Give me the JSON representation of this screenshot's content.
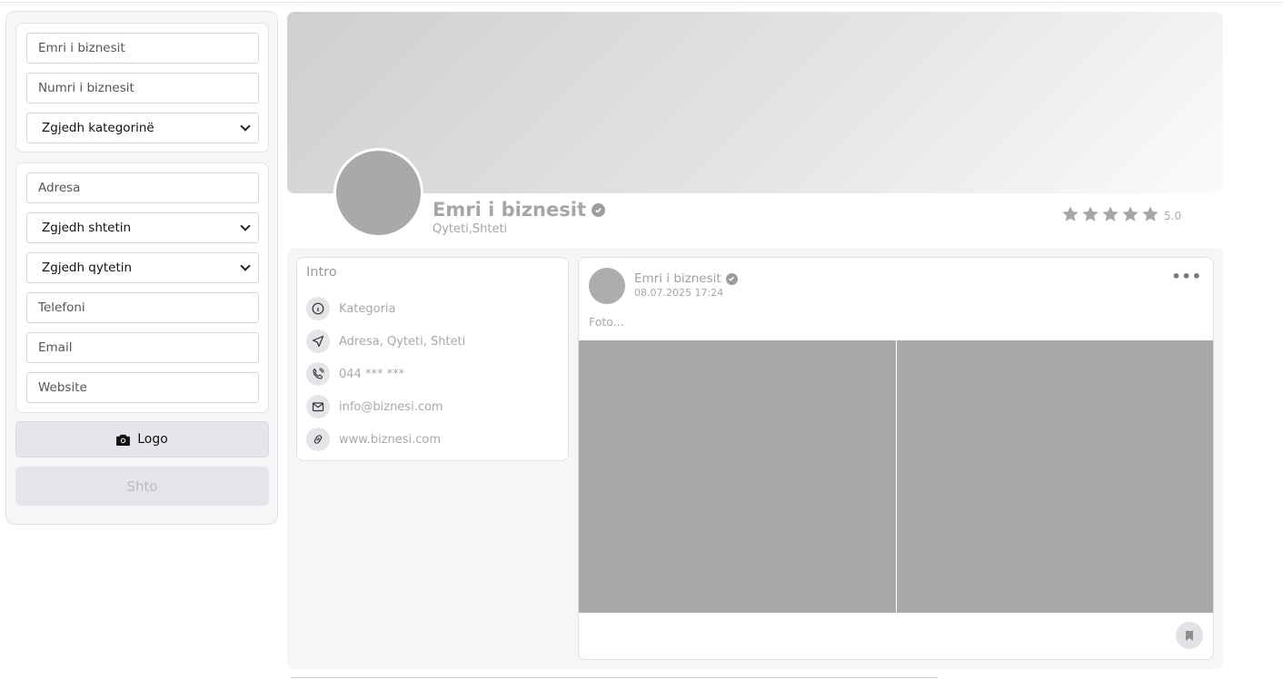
{
  "form": {
    "business_name_placeholder": "Emri i biznesit",
    "business_number_placeholder": "Numri i biznesit",
    "category_select": "Zgjedh kategorinë",
    "address_placeholder": "Adresa",
    "country_select": "Zgjedh shtetin",
    "city_select": "Zgjedh qytetin",
    "phone_placeholder": "Telefoni",
    "email_placeholder": "Email",
    "website_placeholder": "Website",
    "logo_button": "Logo",
    "submit_button": "Shto"
  },
  "profile": {
    "name": "Emri i biznesit",
    "location": "Qyteti,Shteti",
    "rating": 5.0,
    "rating_label": "5.0"
  },
  "intro": {
    "title": "Intro",
    "items": [
      {
        "icon": "info-icon",
        "text": "Kategoria"
      },
      {
        "icon": "location-arrow-icon",
        "text": "Adresa, Qyteti, Shteti"
      },
      {
        "icon": "phone-icon",
        "text": "044 *** ***"
      },
      {
        "icon": "mail-icon",
        "text": "info@biznesi.com"
      },
      {
        "icon": "link-icon",
        "text": "www.biznesi.com"
      }
    ]
  },
  "post": {
    "author": "Emri i biznesit",
    "date": "08.07.2025 17:24",
    "caption": "Foto...",
    "more_label": "•••"
  },
  "colors": {
    "placeholder_gray": "#a9a9a9",
    "panel_bg": "#f5f6f8",
    "button_bg": "#e5e6ea"
  }
}
